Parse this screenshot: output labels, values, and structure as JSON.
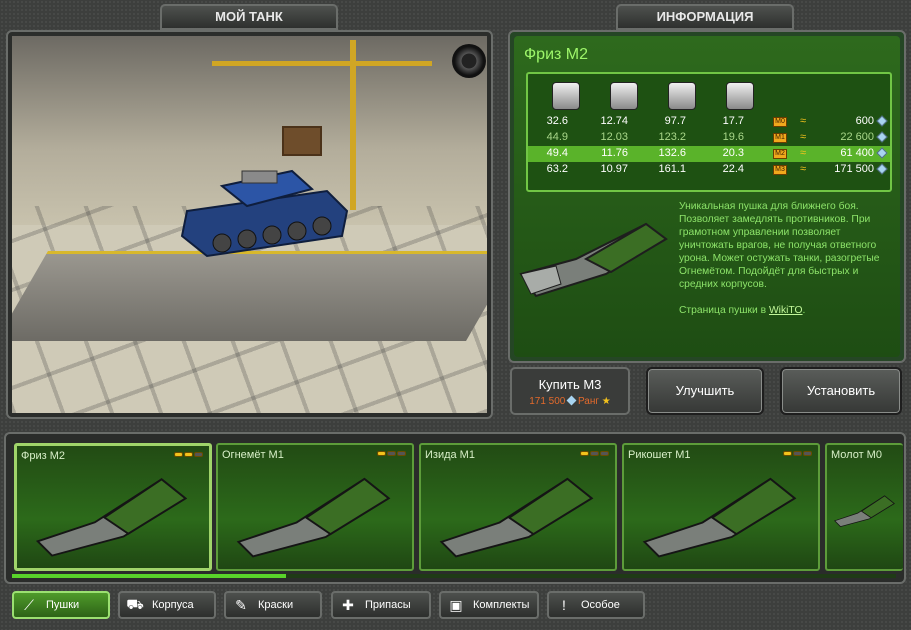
{
  "tabs": {
    "my_tank": "МОЙ ТАНК",
    "info": "ИНФОРМАЦИЯ"
  },
  "item": {
    "title": "Фриз М2",
    "stat_icons": [
      "damage-icon",
      "reload-icon",
      "rotation-icon",
      "range-icon"
    ],
    "rows": [
      {
        "v1": "32.6",
        "v2": "12.74",
        "v3": "97.7",
        "v4": "17.7",
        "mod": "M0",
        "price": "600",
        "color": "#ffffff"
      },
      {
        "v1": "44.9",
        "v2": "12.03",
        "v3": "123.2",
        "v4": "19.6",
        "mod": "M1",
        "price": "22 600",
        "color": "#a9d78a"
      },
      {
        "v1": "49.4",
        "v2": "11.76",
        "v3": "132.6",
        "v4": "20.3",
        "mod": "M2",
        "price": "61 400",
        "color": "#ffffff"
      },
      {
        "v1": "63.2",
        "v2": "10.97",
        "v3": "161.1",
        "v4": "22.4",
        "mod": "M3",
        "price": "171 500",
        "color": "#ffffff"
      }
    ],
    "selected_row": 2,
    "description": "Уникальная пушка для ближнего боя. Позволяет замедлять противников. При грамотном управлении позволяет уничтожать врагов, не получая ответного урона. Может остужать танки, разогретые Огнемётом. Подойдёт для быстрых и средних корпусов.",
    "wiki_prefix": "Страница пушки в ",
    "wiki_link": "WikiTO",
    "wiki_suffix": "."
  },
  "actions": {
    "buy_label": "Купить М3",
    "buy_price": "171 500",
    "buy_rank": "Ранг",
    "upgrade": "Улучшить",
    "install": "Установить"
  },
  "garage": {
    "items": [
      {
        "name": "Фриз М2",
        "level": 2
      },
      {
        "name": "Огнемёт М1",
        "level": 1
      },
      {
        "name": "Изида М1",
        "level": 1
      },
      {
        "name": "Рикошет М1",
        "level": 1
      },
      {
        "name": "Молот М0",
        "level": 0
      }
    ],
    "scroll_progress": 0.31
  },
  "categories": [
    {
      "label": "Пушки",
      "icon": "cannon-icon"
    },
    {
      "label": "Корпуса",
      "icon": "hull-icon"
    },
    {
      "label": "Краски",
      "icon": "paint-icon"
    },
    {
      "label": "Припасы",
      "icon": "wrench-icon"
    },
    {
      "label": "Комплекты",
      "icon": "kit-icon"
    },
    {
      "label": "Особое",
      "icon": "special-icon"
    }
  ],
  "colors": {
    "accent": "#9ef66a",
    "panel_green": "#2b6a1a",
    "gold": "#f4c21c"
  }
}
